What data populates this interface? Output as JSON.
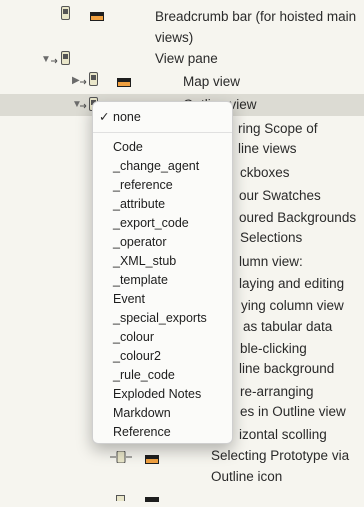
{
  "tree": {
    "rows": [
      {
        "label": "Breadcrumb bar (for hoisted main views)"
      },
      {
        "label": "View pane"
      },
      {
        "label": "Map view"
      },
      {
        "label": "Outline view"
      },
      {
        "label": "ring Scope of"
      },
      {
        "label": "line views"
      },
      {
        "label": "ckboxes"
      },
      {
        "label": "our Swatches"
      },
      {
        "label": "oured Backgrounds"
      },
      {
        "label": "Selections"
      },
      {
        "label": "lumn view:"
      },
      {
        "label": "laying and editing"
      },
      {
        "label": "ying column view"
      },
      {
        "label": "as tabular data"
      },
      {
        "label": "ble-clicking"
      },
      {
        "label": "line background"
      },
      {
        "label": "re-arranging"
      },
      {
        "label": "es in Outline view"
      },
      {
        "label": "izontal scolling"
      },
      {
        "label": "Selecting Prototype via Outline icon"
      }
    ]
  },
  "menu": {
    "checkmark": "✓",
    "items": [
      {
        "label": "none"
      },
      {
        "label": "Code"
      },
      {
        "label": "_change_agent"
      },
      {
        "label": "_reference"
      },
      {
        "label": "_attribute"
      },
      {
        "label": "_export_code"
      },
      {
        "label": "_operator"
      },
      {
        "label": "_XML_stub"
      },
      {
        "label": "_template"
      },
      {
        "label": "Event"
      },
      {
        "label": "_special_exports"
      },
      {
        "label": "_colour"
      },
      {
        "label": "_colour2"
      },
      {
        "label": "_rule_code"
      },
      {
        "label": "Exploded Notes"
      },
      {
        "label": "Markdown"
      },
      {
        "label": "Reference"
      }
    ]
  },
  "colors": {
    "selection": "#dcdbd3",
    "background": "#f6f5ef"
  }
}
